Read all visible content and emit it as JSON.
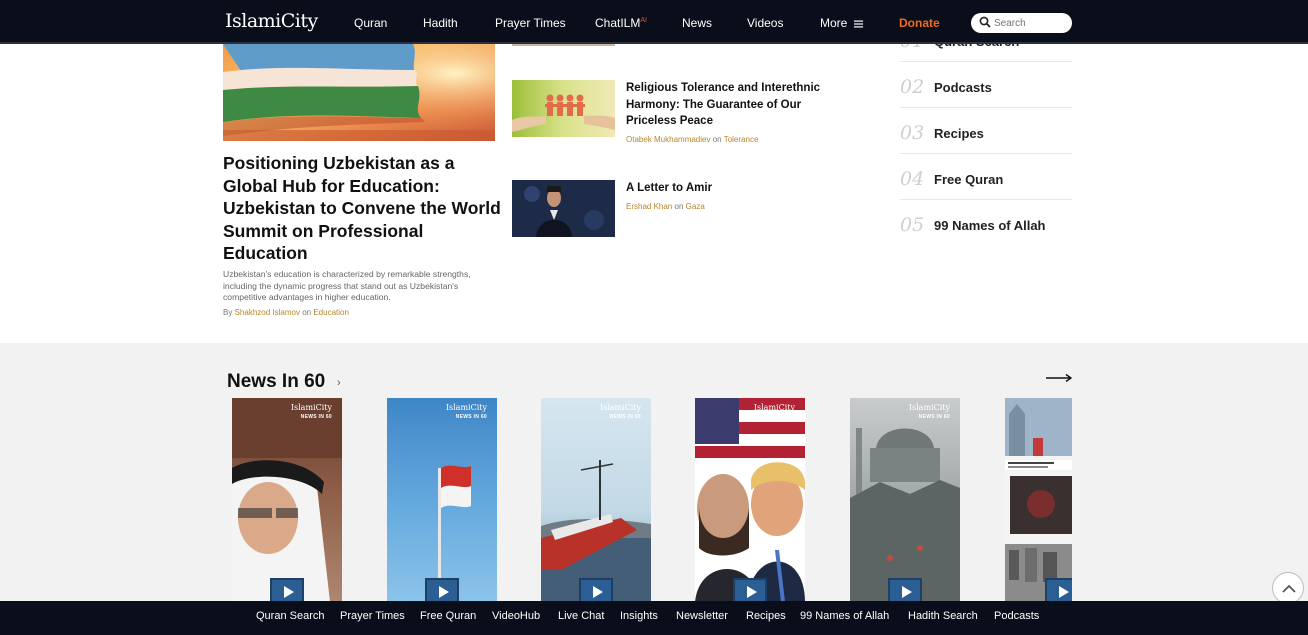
{
  "header": {
    "logo": "IslamiCity",
    "nav": [
      "Quran",
      "Hadith",
      "Prayer Times",
      "ChatILM",
      "News",
      "Videos",
      "More"
    ],
    "chatilm_sup": "AI",
    "more_icon": "hamburger-icon",
    "donate": "Donate",
    "search_placeholder": "Search"
  },
  "featured": {
    "title": "Positioning Uzbekistan as a Global Hub for Education: Uzbekistan to Convene the World Summit on Professional Education",
    "description": "Uzbekistan's education is characterized by remarkable strengths, including the dynamic progress that stand out as Uzbekistan's competitive advantages in higher education.",
    "by": "By",
    "author": "Shakhzod Islamov",
    "on": "on",
    "category": "Education"
  },
  "side_stories": [
    {
      "title": "Religious Tolerance and Interethnic Harmony: The Guarantee of Our Priceless Peace",
      "author": "Otabek Mukhammadiev",
      "on": "on",
      "category": "Tolerance"
    },
    {
      "title": "A Letter to Amir",
      "author": "Ershad Khan",
      "on": "on",
      "category": "Gaza"
    }
  ],
  "popular": [
    {
      "num": "01",
      "label": "Quran Search"
    },
    {
      "num": "02",
      "label": "Podcasts"
    },
    {
      "num": "03",
      "label": "Recipes"
    },
    {
      "num": "04",
      "label": "Free Quran"
    },
    {
      "num": "05",
      "label": "99 Names of Allah"
    }
  ],
  "news60": {
    "title": "News In 60",
    "chevron": "›",
    "card_logo": "IslamiCity",
    "card_sub": "NEWS IN 60",
    "cards": 6
  },
  "footer": [
    "Quran Search",
    "Prayer Times",
    "Free Quran",
    "VideoHub",
    "Live Chat",
    "Insights",
    "Newsletter",
    "Recipes",
    "99 Names of Allah",
    "Hadith Search",
    "Podcasts"
  ],
  "colors": {
    "header_bg": "#0a0e1a",
    "donate": "#f06a1c",
    "accent_gold": "#b8862c",
    "news_bg": "#f2f2f2"
  }
}
